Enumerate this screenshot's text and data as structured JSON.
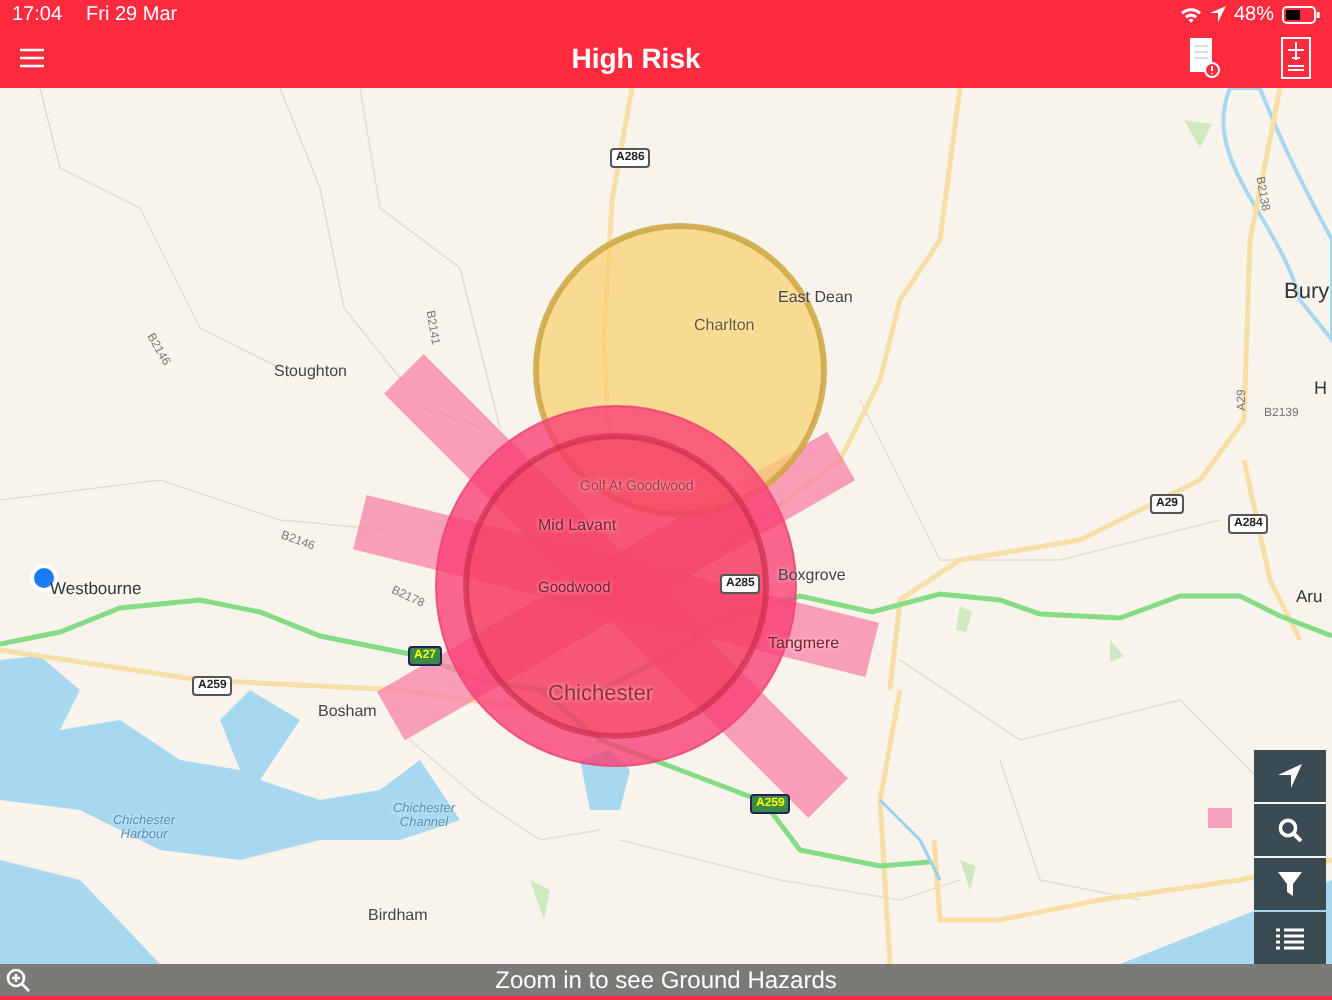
{
  "status_bar": {
    "time": "17:04",
    "date": "Fri 29 Mar",
    "battery": "48%"
  },
  "header": {
    "title": "High Risk"
  },
  "map": {
    "places": [
      {
        "name": "Stoughton"
      },
      {
        "name": "Charlton"
      },
      {
        "name": "East Dean"
      },
      {
        "name": "Bury"
      },
      {
        "name": "H"
      },
      {
        "name": "Golf At Goodwood"
      },
      {
        "name": "Mid Lavant"
      },
      {
        "name": "Goodwood"
      },
      {
        "name": "Westbourne"
      },
      {
        "name": "Boxgrove"
      },
      {
        "name": "Tangmere"
      },
      {
        "name": "Chichester"
      },
      {
        "name": "Aru"
      },
      {
        "name": "Bosham"
      },
      {
        "name": "Chichester Harbour"
      },
      {
        "name": "Chichester Channel"
      },
      {
        "name": "Birdham"
      }
    ],
    "road_labels": [
      {
        "text": "A286",
        "kind": "a-road"
      },
      {
        "text": "B2141",
        "kind": "b-road"
      },
      {
        "text": "B2146",
        "kind": "b-road"
      },
      {
        "text": "B2146",
        "kind": "b-road"
      },
      {
        "text": "B2178",
        "kind": "b-road"
      },
      {
        "text": "A27",
        "kind": "primary"
      },
      {
        "text": "A259",
        "kind": "a-road"
      },
      {
        "text": "A285",
        "kind": "a-road"
      },
      {
        "text": "A29",
        "kind": "a-road"
      },
      {
        "text": "A284",
        "kind": "a-road"
      },
      {
        "text": "A29",
        "kind": "b-road"
      },
      {
        "text": "B2139",
        "kind": "b-road"
      },
      {
        "text": "B2138",
        "kind": "b-road"
      },
      {
        "text": "A259",
        "kind": "primary"
      }
    ]
  },
  "hint": "Zoom in to see Ground Hazards"
}
